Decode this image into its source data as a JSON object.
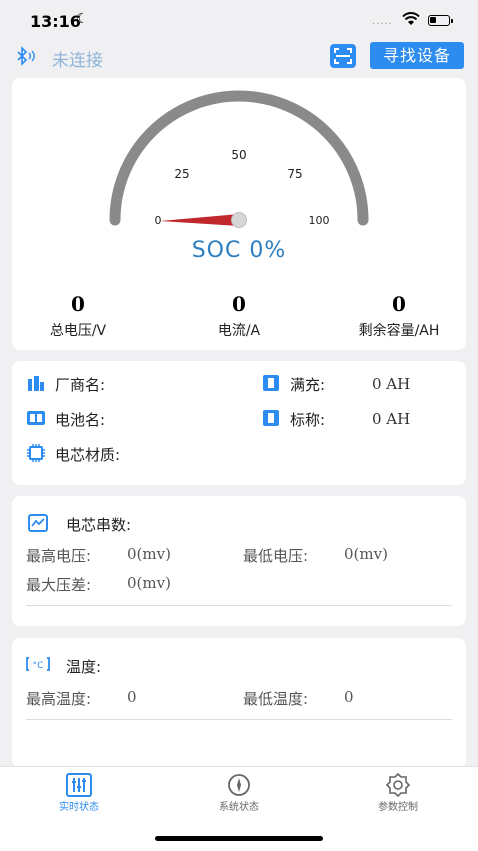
{
  "status_bar": {
    "time": "13:16",
    "signal_dots": "....."
  },
  "header": {
    "connection_status": "未连接",
    "find_device_label": "寻找设备"
  },
  "gauge": {
    "ticks": [
      "0",
      "25",
      "50",
      "75",
      "100"
    ],
    "soc_label": "SOC 0%",
    "soc_value": 0
  },
  "stats": [
    {
      "value": "0",
      "label": "总电压/V"
    },
    {
      "value": "0",
      "label": "电流/A"
    },
    {
      "value": "0",
      "label": "剩余容量/AH"
    }
  ],
  "battery_info": {
    "manufacturer_label": "厂商名:",
    "battery_name_label": "电池名:",
    "cell_material_label": "电芯材质:",
    "full_charge_label": "满充:",
    "full_charge_value": "0 AH",
    "nominal_label": "标称:",
    "nominal_value": "0 AH"
  },
  "cells": {
    "title": "电芯串数:",
    "max_voltage_label": "最高电压:",
    "max_voltage_value": "0(mv)",
    "min_voltage_label": "最低电压:",
    "min_voltage_value": "0(mv)",
    "max_diff_label": "最大压差:",
    "max_diff_value": "0(mv)"
  },
  "temperature": {
    "title": "温度:",
    "max_temp_label": "最高温度:",
    "max_temp_value": "0",
    "min_temp_label": "最低温度:",
    "min_temp_value": "0"
  },
  "tabs": [
    {
      "label": "实时状态",
      "active": true
    },
    {
      "label": "系统状态",
      "active": false
    },
    {
      "label": "参数控制",
      "active": false
    }
  ],
  "colors": {
    "accent": "#2d8cf0",
    "soc_text": "#2d7fc1",
    "needle": "#c0282d",
    "gauge_arc": "#8a8a8a"
  }
}
